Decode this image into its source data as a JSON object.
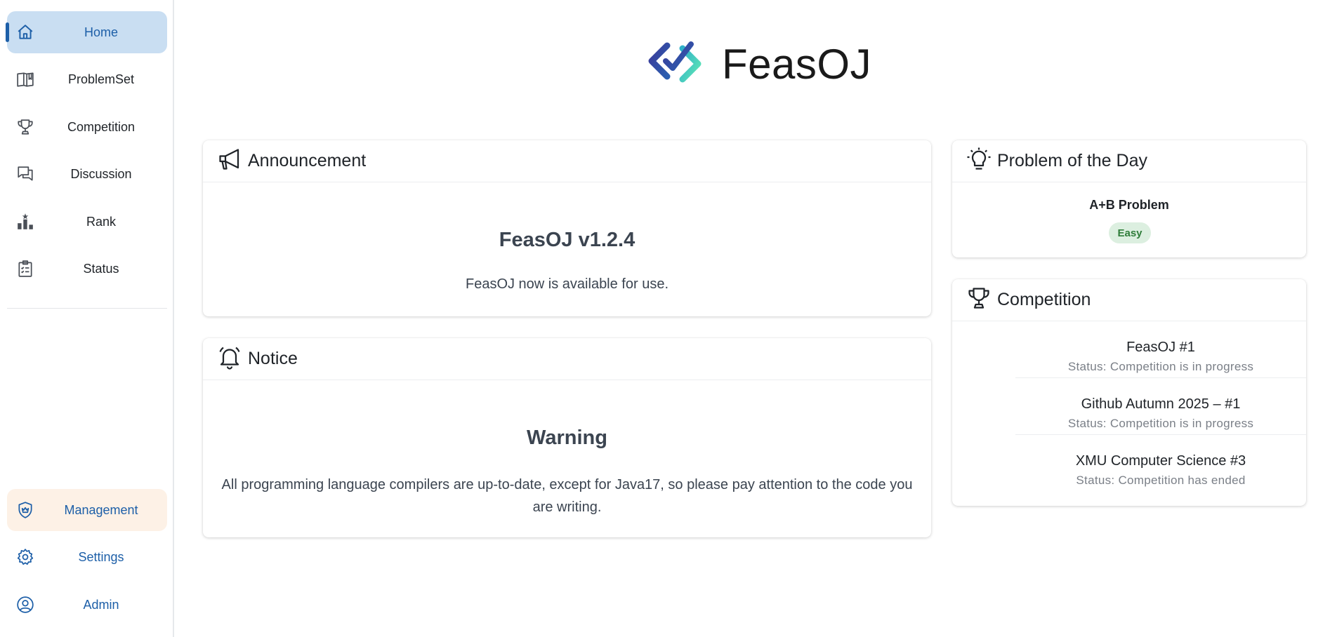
{
  "sidebar": {
    "items": [
      {
        "label": "Home",
        "icon": "home-icon"
      },
      {
        "label": "ProblemSet",
        "icon": "book-icon"
      },
      {
        "label": "Competition",
        "icon": "trophy-icon"
      },
      {
        "label": "Discussion",
        "icon": "chat-icon"
      },
      {
        "label": "Rank",
        "icon": "rank-icon"
      },
      {
        "label": "Status",
        "icon": "clipboard-icon"
      }
    ],
    "bottom_items": [
      {
        "label": "Management",
        "icon": "shield-icon"
      },
      {
        "label": "Settings",
        "icon": "gear-icon"
      },
      {
        "label": "Admin",
        "icon": "user-circle-icon"
      }
    ]
  },
  "brand": {
    "name": "FeasOJ",
    "logo": "feasoj-logo-icon"
  },
  "announcement": {
    "heading": "Announcement",
    "title": "FeasOJ v1.2.4",
    "text": "FeasOJ now is available for use."
  },
  "notice": {
    "heading": "Notice",
    "title": "Warning",
    "text": "All programming language compilers are up-to-date, except for Java17, so please pay attention to the code you are writing."
  },
  "problem_of_day": {
    "heading": "Problem of the Day",
    "name": "A+B Problem",
    "difficulty": "Easy"
  },
  "competition": {
    "heading": "Competition",
    "items": [
      {
        "name": "FeasOJ #1",
        "status": "Status: Competition is in progress"
      },
      {
        "name": "Github Autumn 2025 – #1",
        "status": "Status: Competition is in progress"
      },
      {
        "name": "XMU Computer Science #3",
        "status": "Status: Competition has ended"
      }
    ]
  },
  "colors": {
    "accent": "#1d5fa8",
    "active_bg": "#c9def2",
    "management_bg": "#fdf1e6",
    "easy_bg": "#dcefe0",
    "easy_text": "#2f7d3a"
  }
}
